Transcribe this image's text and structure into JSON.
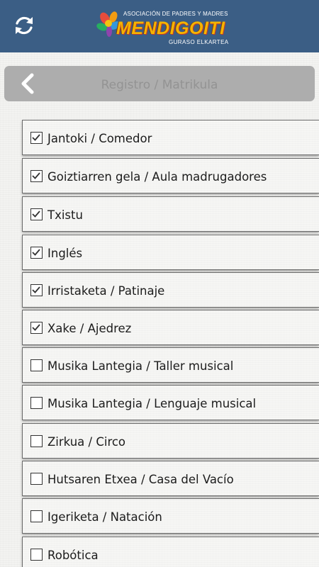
{
  "topbar": {
    "refresh_icon": "refresh-icon",
    "logo": {
      "top_line": "ASOCIACIÓN DE PADRES Y MADRES",
      "name": "MENDIGOITI",
      "bottom_line": "GURASO ELKARTEA"
    }
  },
  "header": {
    "back_icon": "chevron-left-icon",
    "title": "Registro / Matrikula"
  },
  "activities": [
    {
      "label": "Jantoki / Comedor",
      "checked": true
    },
    {
      "label": "Goiztiarren gela / Aula madrugadores",
      "checked": true
    },
    {
      "label": "Txistu",
      "checked": true
    },
    {
      "label": "Inglés",
      "checked": true
    },
    {
      "label": "Irristaketa / Patinaje",
      "checked": true
    },
    {
      "label": "Xake / Ajedrez",
      "checked": true
    },
    {
      "label": "Musika Lantegia / Taller musical",
      "checked": false
    },
    {
      "label": "Musika Lantegia / Lenguaje musical",
      "checked": false
    },
    {
      "label": "Zirkua / Circo",
      "checked": false
    },
    {
      "label": "Hutsaren Etxea / Casa del Vacío",
      "checked": false
    },
    {
      "label": "Igeriketa / Natación",
      "checked": false
    },
    {
      "label": "Robótica",
      "checked": false
    }
  ],
  "colors": {
    "topbar": "#3b5e85",
    "header_bar": "#adadad",
    "header_text": "#939393",
    "logo_accent": "#f4b400"
  }
}
